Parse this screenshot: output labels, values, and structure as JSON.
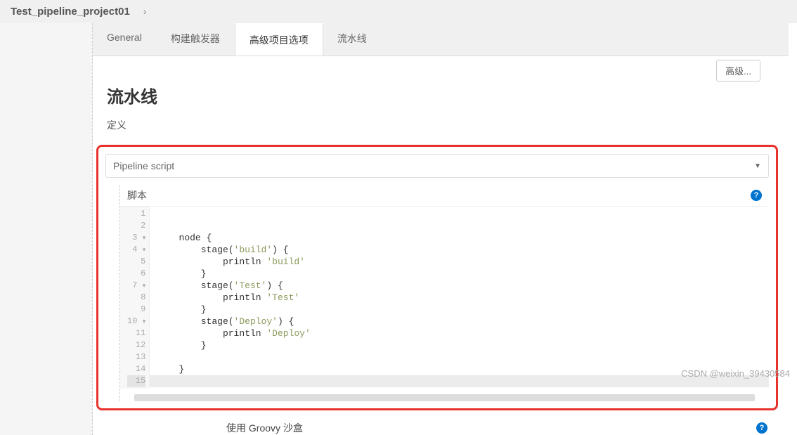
{
  "breadcrumb": {
    "project_name": "Test_pipeline_project01",
    "separator": "›"
  },
  "tabs": {
    "general": "General",
    "build_triggers": "构建触发器",
    "advanced_options": "高级项目选项",
    "pipeline": "流水线"
  },
  "buttons": {
    "advanced": "高级..."
  },
  "pipeline_section": {
    "title": "流水线",
    "definition_label": "定义",
    "definition_value": "Pipeline script",
    "script_label": "脚本",
    "help_tooltip": "?"
  },
  "code": {
    "lines": [
      "",
      "",
      "    node {",
      "        stage('build') {",
      "            println 'build'",
      "        }",
      "        stage('Test') {",
      "            println 'Test'",
      "        }",
      "        stage('Deploy') {",
      "            println 'Deploy'",
      "        }",
      "",
      "    }",
      ""
    ],
    "fold_lines": [
      3,
      4,
      7,
      10
    ],
    "current_line": 15
  },
  "footer": {
    "groovy_sandbox": "使用 Groovy 沙盒"
  },
  "watermark": "CSDN @weixin_39430584"
}
